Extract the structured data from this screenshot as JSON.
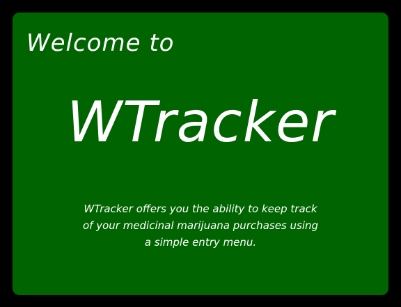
{
  "welcome": {
    "greeting": "Welcome to",
    "app_name": "WTracker",
    "description_lines": [
      "WTracker offers you the ability to keep track",
      "of your medicinal marijuana purchases using",
      "a simple entry menu."
    ]
  },
  "colors": {
    "frame": "#000000",
    "panel": "#006400",
    "text": "#ffffff"
  }
}
